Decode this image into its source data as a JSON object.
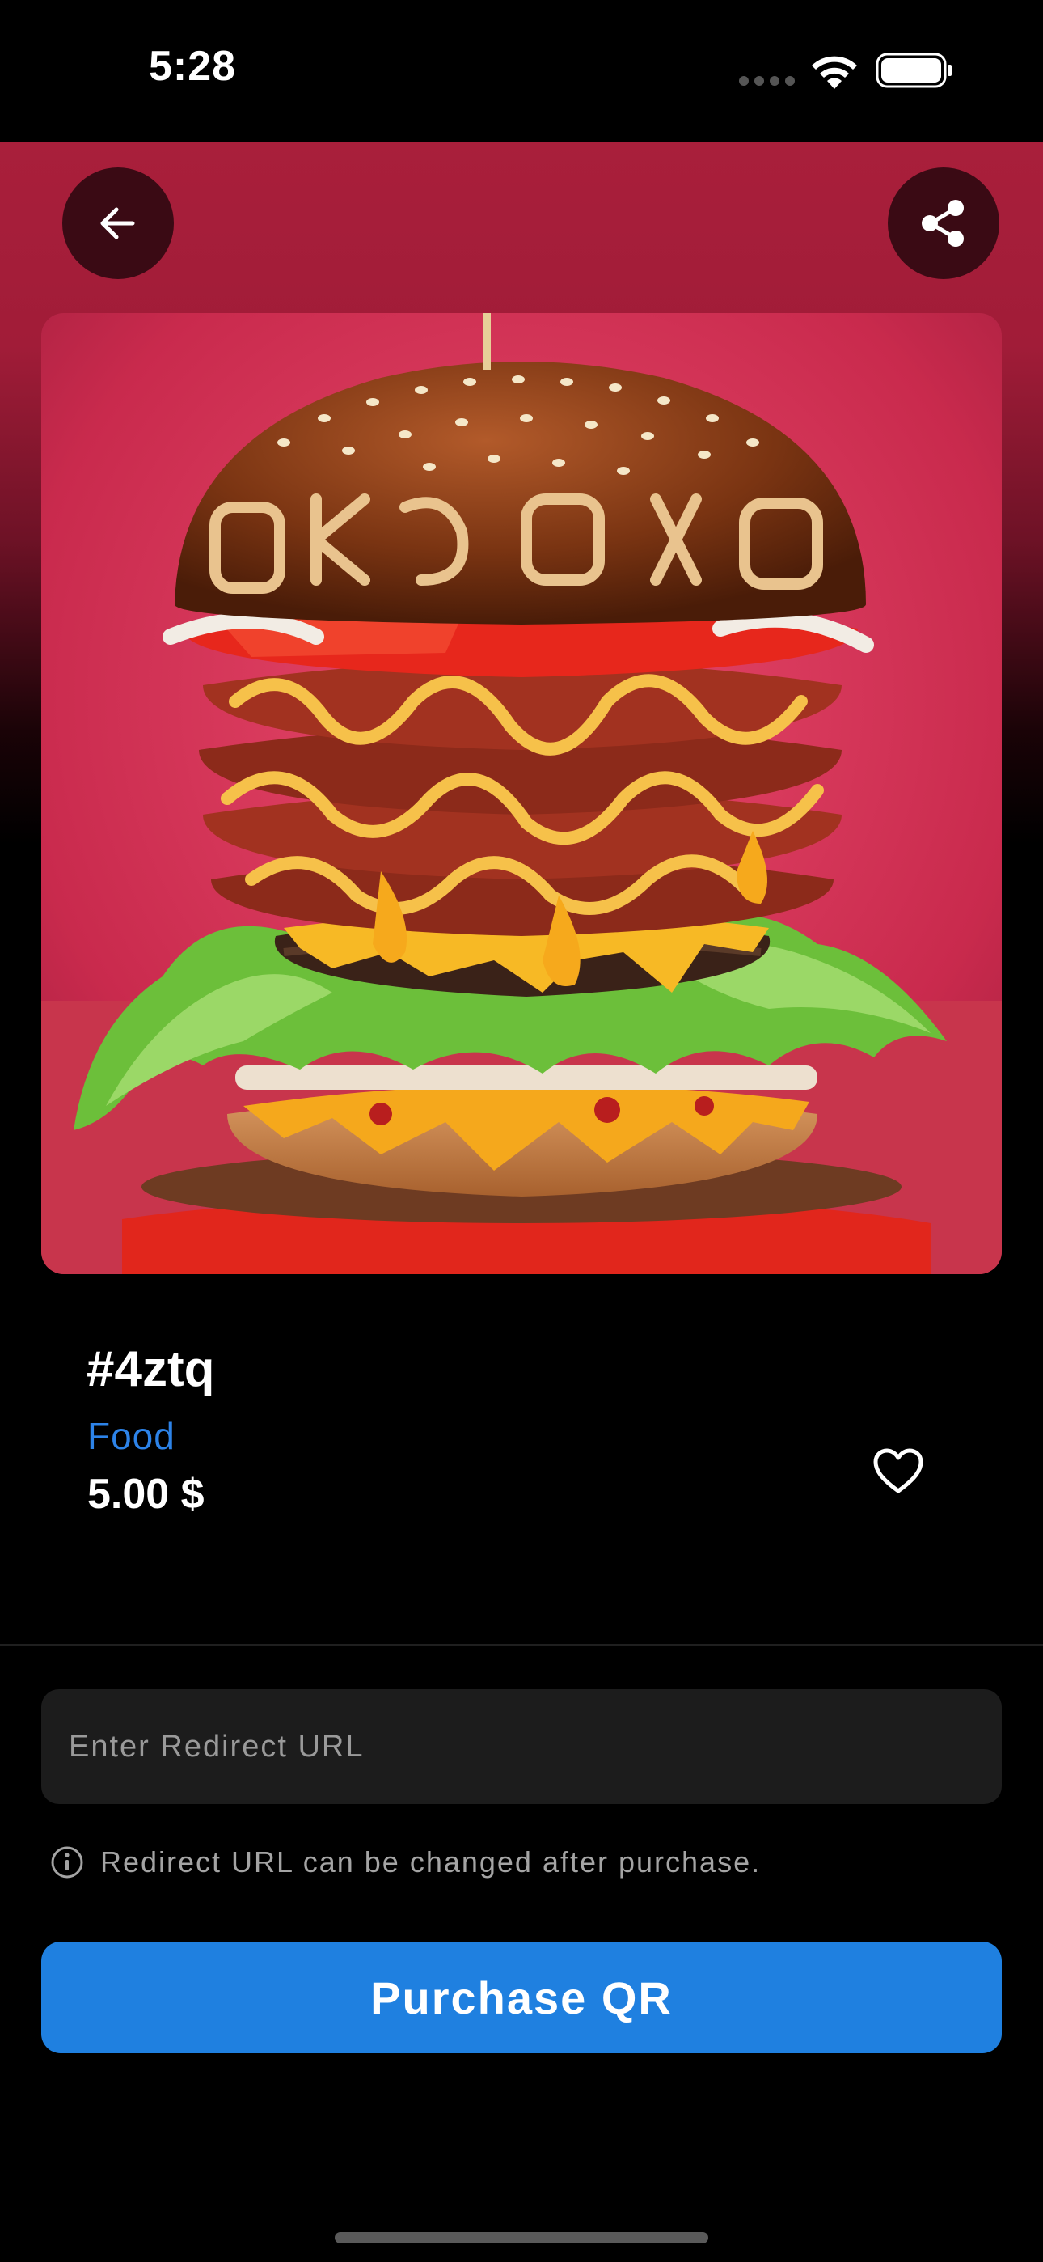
{
  "status_bar": {
    "time": "5:28",
    "icons": [
      "cellular-dots-icon",
      "wifi-icon",
      "battery-icon"
    ]
  },
  "header": {
    "back_icon": "arrow-left-icon",
    "share_icon": "share-icon"
  },
  "product": {
    "image_subject": "burger",
    "id": "#4ztq",
    "category": "Food",
    "price": "5.00 $",
    "favorite_icon": "heart-outline-icon"
  },
  "redirect": {
    "placeholder": "Enter Redirect URL",
    "value": "",
    "hint": "Redirect URL can be changed after purchase.",
    "hint_icon": "info-circle-icon"
  },
  "actions": {
    "purchase_label": "Purchase QR"
  },
  "colors": {
    "hero_red": "#a91f3b",
    "accent_blue": "#1f80e0",
    "category_blue": "#2d83e8",
    "field_bg": "#1c1c1c"
  }
}
